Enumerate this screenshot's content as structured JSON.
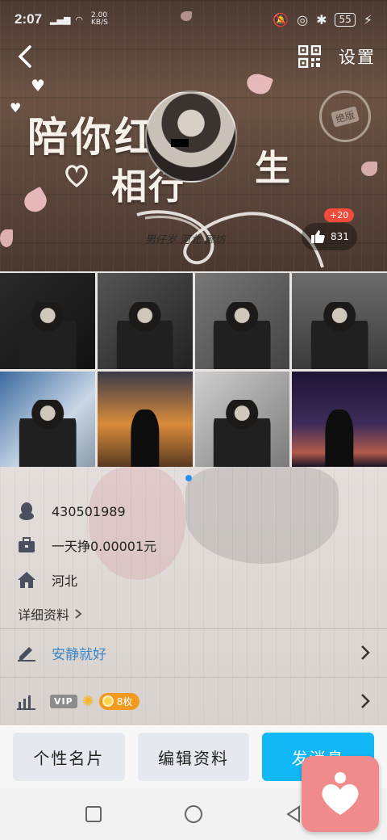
{
  "status_bar": {
    "time": "2:07",
    "signal": "4G",
    "net_speed": "2.00",
    "net_unit": "KB/S",
    "battery": "55"
  },
  "header": {
    "settings_label": "设置",
    "like_count": "831",
    "like_plus": "+20",
    "banner_line1": "陪你红",
    "banner_line2": "相行",
    "banner_line3": "生",
    "stamp_text": "绝版",
    "signature": "男仔岁 河北 廊坊"
  },
  "photos": [
    "photo-1",
    "photo-2",
    "photo-3",
    "photo-4",
    "photo-5",
    "photo-6",
    "photo-7",
    "photo-8"
  ],
  "pager": {
    "total": 2,
    "active": 0
  },
  "profile": {
    "qq_number": "430501989",
    "job": "一天挣0.00001元",
    "location": "河北",
    "detail_label": "详细资料",
    "signature": "安静就好",
    "vip_label": "VIP",
    "coin_label": "8枚"
  },
  "actions": {
    "card_label": "个性名片",
    "edit_label": "编辑资料",
    "send_label": "发消息"
  },
  "colors": {
    "accent_blue": "#12b7f5",
    "signature_blue": "#3a86c8",
    "badge_red": "#f24a3b",
    "coin_orange": "#f39a1e",
    "heart_pink": "#f08b8b"
  }
}
